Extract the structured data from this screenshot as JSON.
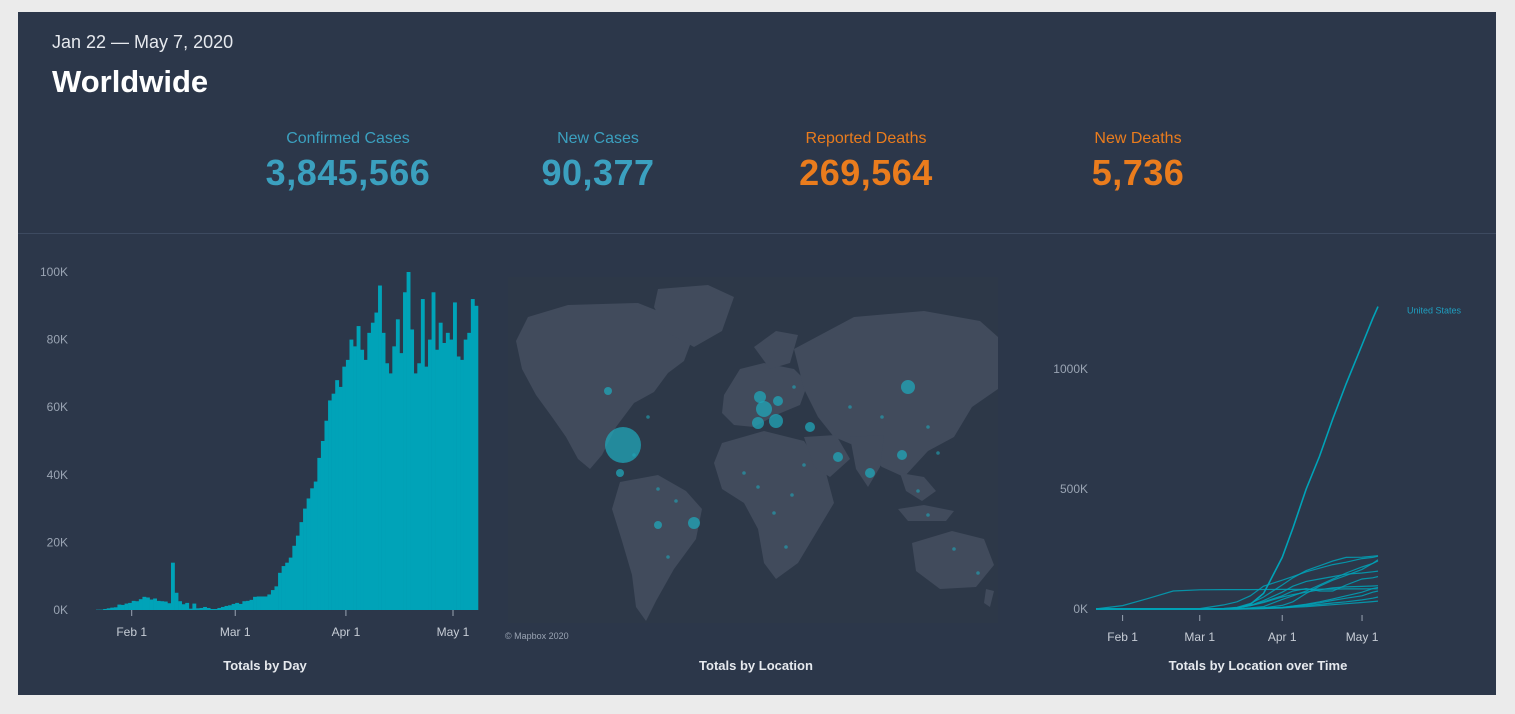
{
  "header": {
    "date_range": "Jan 22 — May 7, 2020",
    "title": "Worldwide"
  },
  "kpis": [
    {
      "label": "Confirmed Cases",
      "value": "3,845,566",
      "color": "#3ba0bf"
    },
    {
      "label": "New Cases",
      "value": "90,377",
      "color": "#3ba0bf"
    },
    {
      "label": "Reported Deaths",
      "value": "269,564",
      "color": "#ea7c1d"
    },
    {
      "label": "New Deaths",
      "value": "5,736",
      "color": "#ea7c1d"
    }
  ],
  "map": {
    "title": "Totals by Location",
    "credit": "© Mapbox 2020"
  },
  "colors": {
    "background": "#2c374a",
    "accent_teal": "#00a3b8",
    "accent_orange": "#ea7c1d",
    "land": "#414b5c"
  },
  "chart_data": [
    {
      "type": "bar",
      "title": "Totals by Day",
      "xlabel": "",
      "ylabel": "",
      "x_ticks": [
        "Feb 1",
        "Mar 1",
        "Apr 1",
        "May 1"
      ],
      "x_tick_dates": [
        "2020-02-01",
        "2020-03-01",
        "2020-04-01",
        "2020-05-01"
      ],
      "y_ticks": [
        "0K",
        "20K",
        "40K",
        "60K",
        "80K",
        "100K"
      ],
      "y_tick_values": [
        0,
        20000,
        40000,
        60000,
        80000,
        100000
      ],
      "ylim": [
        0,
        100000
      ],
      "x_range": [
        "2020-01-22",
        "2020-05-07"
      ],
      "grid": false,
      "categories": [
        "2020-01-22",
        "2020-01-23",
        "2020-01-24",
        "2020-01-25",
        "2020-01-26",
        "2020-01-27",
        "2020-01-28",
        "2020-01-29",
        "2020-01-30",
        "2020-01-31",
        "2020-02-01",
        "2020-02-02",
        "2020-02-03",
        "2020-02-04",
        "2020-02-05",
        "2020-02-06",
        "2020-02-07",
        "2020-02-08",
        "2020-02-09",
        "2020-02-10",
        "2020-02-11",
        "2020-02-12",
        "2020-02-13",
        "2020-02-14",
        "2020-02-15",
        "2020-02-16",
        "2020-02-17",
        "2020-02-18",
        "2020-02-19",
        "2020-02-20",
        "2020-02-21",
        "2020-02-22",
        "2020-02-23",
        "2020-02-24",
        "2020-02-25",
        "2020-02-26",
        "2020-02-27",
        "2020-02-28",
        "2020-02-29",
        "2020-03-01",
        "2020-03-02",
        "2020-03-03",
        "2020-03-04",
        "2020-03-05",
        "2020-03-06",
        "2020-03-07",
        "2020-03-08",
        "2020-03-09",
        "2020-03-10",
        "2020-03-11",
        "2020-03-12",
        "2020-03-13",
        "2020-03-14",
        "2020-03-15",
        "2020-03-16",
        "2020-03-17",
        "2020-03-18",
        "2020-03-19",
        "2020-03-20",
        "2020-03-21",
        "2020-03-22",
        "2020-03-23",
        "2020-03-24",
        "2020-03-25",
        "2020-03-26",
        "2020-03-27",
        "2020-03-28",
        "2020-03-29",
        "2020-03-30",
        "2020-03-31",
        "2020-04-01",
        "2020-04-02",
        "2020-04-03",
        "2020-04-04",
        "2020-04-05",
        "2020-04-06",
        "2020-04-07",
        "2020-04-08",
        "2020-04-09",
        "2020-04-10",
        "2020-04-11",
        "2020-04-12",
        "2020-04-13",
        "2020-04-14",
        "2020-04-15",
        "2020-04-16",
        "2020-04-17",
        "2020-04-18",
        "2020-04-19",
        "2020-04-20",
        "2020-04-21",
        "2020-04-22",
        "2020-04-23",
        "2020-04-24",
        "2020-04-25",
        "2020-04-26",
        "2020-04-27",
        "2020-04-28",
        "2020-04-29",
        "2020-04-30",
        "2020-05-01",
        "2020-05-02",
        "2020-05-03",
        "2020-05-04",
        "2020-05-05",
        "2020-05-06",
        "2020-05-07"
      ],
      "values": [
        100,
        100,
        300,
        500,
        700,
        800,
        1600,
        1500,
        1900,
        2100,
        2700,
        2600,
        3200,
        3900,
        3700,
        3100,
        3400,
        2700,
        2600,
        2500,
        2000,
        14000,
        5100,
        2600,
        1700,
        2100,
        400,
        1900,
        500,
        600,
        900,
        600,
        300,
        300,
        600,
        900,
        1200,
        1400,
        1800,
        2100,
        1800,
        2600,
        2700,
        3000,
        3900,
        4000,
        4000,
        4000,
        4600,
        5900,
        7000,
        11000,
        13000,
        14000,
        15500,
        19000,
        22000,
        26000,
        30000,
        33000,
        36000,
        38000,
        45000,
        50000,
        56000,
        62000,
        64000,
        68000,
        66000,
        72000,
        74000,
        80000,
        78000,
        84000,
        77000,
        74000,
        82000,
        85000,
        88000,
        96000,
        82000,
        73000,
        70000,
        78000,
        86000,
        76000,
        94000,
        100000,
        83000,
        70000,
        73000,
        92000,
        72000,
        80000,
        94000,
        77000,
        85000,
        79000,
        82000,
        80000,
        91000,
        75000,
        74000,
        80000,
        82000,
        92000,
        90000
      ]
    },
    {
      "type": "line",
      "title": "Totals by Location over Time",
      "xlabel": "",
      "ylabel": "",
      "x_ticks": [
        "Feb 1",
        "Mar 1",
        "Apr 1",
        "May 1"
      ],
      "x_tick_dates": [
        "2020-02-01",
        "2020-03-01",
        "2020-04-01",
        "2020-05-01"
      ],
      "y_ticks": [
        "0K",
        "500K",
        "1000K"
      ],
      "y_tick_values": [
        0,
        500000,
        1000000
      ],
      "ylim": [
        0,
        1300000
      ],
      "x_range": [
        "2020-01-22",
        "2020-05-07"
      ],
      "grid": false,
      "x": [
        "2020-01-22",
        "2020-02-01",
        "2020-02-10",
        "2020-02-20",
        "2020-03-01",
        "2020-03-10",
        "2020-03-15",
        "2020-03-20",
        "2020-03-25",
        "2020-04-01",
        "2020-04-05",
        "2020-04-10",
        "2020-04-15",
        "2020-04-20",
        "2020-04-25",
        "2020-05-01",
        "2020-05-05",
        "2020-05-07"
      ],
      "series": [
        {
          "name": "United States",
          "label": "United States",
          "values": [
            1,
            8,
            12,
            15,
            75,
            1000,
            3500,
            19000,
            65000,
            215000,
            337000,
            500000,
            636000,
            792000,
            938000,
            1100000,
            1210000,
            1260000
          ]
        },
        {
          "values": [
            548,
            14000,
            42000,
            75000,
            79800,
            80750,
            80840,
            80970,
            81200,
            81550,
            81700,
            81950,
            82300,
            82750,
            83900,
            83950,
            83970,
            84000
          ]
        },
        {
          "values": [
            0,
            0,
            0,
            5,
            1700,
            17000,
            30000,
            55000,
            95000,
            120000,
            135000,
            155000,
            170000,
            185000,
            195000,
            210000,
            215000,
            220000
          ]
        },
        {
          "values": [
            0,
            0,
            0,
            2,
            80,
            2000,
            7000,
            23000,
            50000,
            100000,
            130000,
            160000,
            180000,
            200000,
            215000,
            216000,
            220000,
            222000
          ]
        },
        {
          "values": [
            0,
            0,
            0,
            0,
            20,
            200,
            1500,
            5000,
            10000,
            40000,
            55000,
            75000,
            100000,
            125000,
            150000,
            175000,
            190000,
            200000
          ]
        },
        {
          "values": [
            0,
            0,
            0,
            0,
            100,
            1000,
            5000,
            15000,
            35000,
            70000,
            95000,
            115000,
            125000,
            135000,
            145000,
            150000,
            155000,
            158000
          ]
        },
        {
          "values": [
            0,
            0,
            0,
            0,
            110,
            1400,
            5000,
            14000,
            27000,
            50000,
            60000,
            70000,
            80000,
            88000,
            92000,
            94000,
            96000,
            97000
          ]
        },
        {
          "values": [
            0,
            0,
            0,
            0,
            200,
            1000,
            6000,
            14000,
            30000,
            55000,
            75000,
            85000,
            75000,
            75000,
            100000,
            125000,
            130000,
            135000
          ]
        },
        {
          "values": [
            0,
            0,
            0,
            0,
            30,
            200,
            500,
            1500,
            5000,
            15000,
            30000,
            65000,
            95000,
            120000,
            140000,
            165000,
            190000,
            205000
          ]
        },
        {
          "values": [
            0,
            0,
            0,
            0,
            5,
            50,
            200,
            800,
            4500,
            6000,
            12000,
            20000,
            30000,
            42000,
            55000,
            70000,
            85000,
            90000
          ]
        },
        {
          "values": [
            0,
            0,
            0,
            0,
            5,
            50,
            200,
            900,
            3500,
            7000,
            12000,
            18000,
            26000,
            36000,
            45000,
            55000,
            70000,
            75000
          ]
        },
        {
          "values": [
            0,
            0,
            0,
            0,
            0,
            30,
            150,
            500,
            2000,
            6000,
            10000,
            14000,
            19000,
            25000,
            30000,
            38000,
            45000,
            50000
          ]
        },
        {
          "values": [
            0,
            0,
            0,
            0,
            0,
            20,
            100,
            400,
            1500,
            4000,
            7000,
            10000,
            14000,
            18000,
            22000,
            27000,
            31000,
            33000
          ]
        }
      ]
    }
  ]
}
